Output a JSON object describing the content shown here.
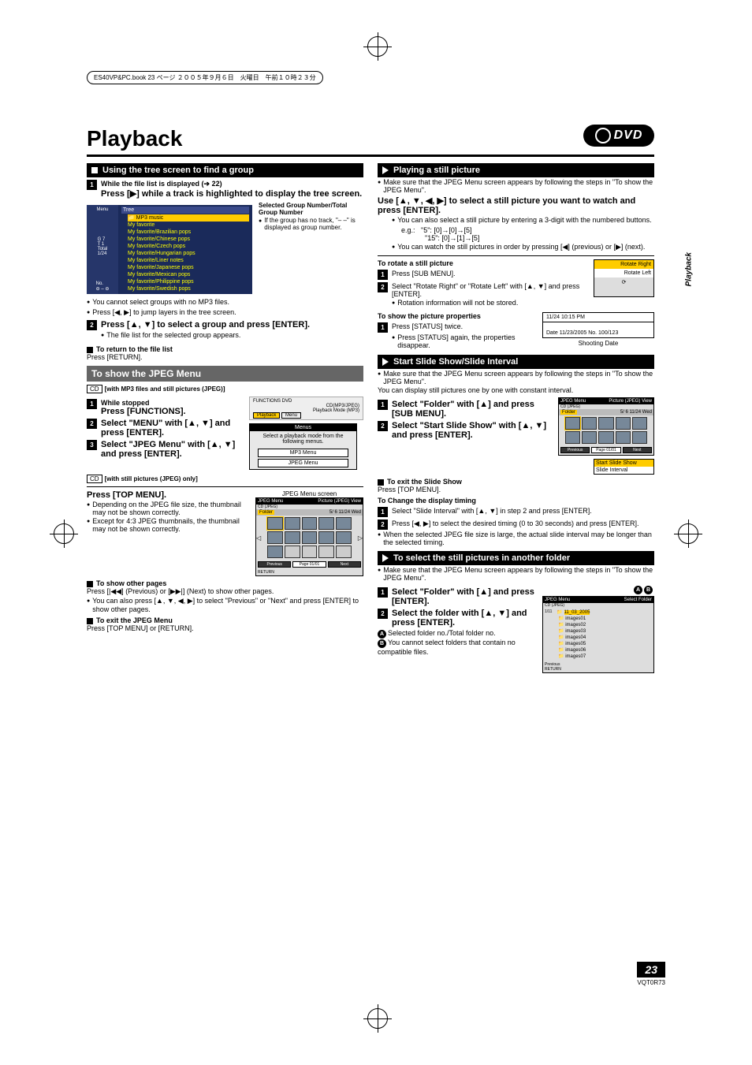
{
  "print_header": "ES40VP&PC.book  23 ページ  ２００５年９月６日　火曜日　午前１０時２３分",
  "title": "Playback",
  "dvd": "DVD",
  "side_tab": "Playback",
  "left": {
    "h1": "Using the tree screen to find a group",
    "s1_lead": "While the file list is displayed (➔ 22)",
    "s1_body": "Press [▶] while a track is highlighted to display the tree screen.",
    "tree": {
      "menu": "Menu",
      "g": "G",
      "gval": "7",
      "t": "T",
      "tval": "1",
      "total": "Total",
      "pad": "1/24",
      "no": "No.",
      "tree_hd": "Tree",
      "cur": "MP3 music",
      "items": [
        "My favorite",
        "My favorite/Brazilian pops",
        "My favorite/Chinese pops",
        "My favorite/Czech pops",
        "My favorite/Hungarian pops",
        "My favorite/Liner notes",
        "My favorite/Japanese pops",
        "My favorite/Mexican pops",
        "My favorite/Philippine pops",
        "My favorite/Swedish pops"
      ]
    },
    "tree_cap1": "Selected Group Number/Total Group Number",
    "tree_cap2": "If the group has no track, \"– –\" is displayed as group number.",
    "b1": "You cannot select groups with no MP3 files.",
    "b2": "Press [◀, ▶] to jump layers in the tree screen.",
    "s2": "Press [▲, ▼] to select a group and press [ENTER].",
    "s2_note": "The file list for the selected group appears.",
    "return_h": "To return to the file list",
    "return_t": "Press [RETURN].",
    "h2": "To show the JPEG Menu",
    "cd1": "[with MP3 files and still pictures (JPEG)]",
    "fs1": "While stopped",
    "fs1b": "Press [FUNCTIONS].",
    "fs2": "Select \"MENU\" with [▲, ▼] and press [ENTER].",
    "fs3": "Select \"JPEG Menu\" with [▲, ▼] and press [ENTER].",
    "funcbox": {
      "top1": "FUNCTIONS   DVD",
      "top2": "CD(MP3/JPEG)",
      "top3": "Playback Mode (MP3)",
      "playbtn": "Playback",
      "menubtn": "Menu",
      "hdr": "Menus",
      "sub": "Select a playback mode from the following menus.",
      "b1": "MP3 Menu",
      "b2": "JPEG Menu"
    },
    "cd2": "[with still pictures (JPEG) only]",
    "top": "Press [TOP MENU].",
    "jcap": "JPEG Menu screen",
    "jb1": "Depending on the JPEG file size, the thumbnail may not be shown correctly.",
    "jb2": "Except for 4:3 JPEG thumbnails, the thumbnail may not be shown correctly.",
    "jmenu": {
      "hd1": "JPEG Menu",
      "hd2": "Picture (JPEG) View",
      "sub": "CD (JPEG)",
      "folder": "Folder",
      "info": "5/   6   11/24  Wed",
      "prev": "Previous",
      "page": "Page 01/01",
      "next": "Next",
      "ret": "RETURN"
    },
    "other_h": "To show other pages",
    "other_t1": "Press [|◀◀] (Previous) or [▶▶|] (Next) to show other pages.",
    "other_t2": "You can also press [▲, ▼, ◀, ▶] to select \"Previous\" or \"Next\" and press [ENTER] to show other pages.",
    "exit_h": "To exit the JPEG Menu",
    "exit_t": "Press [TOP MENU] or [RETURN]."
  },
  "right": {
    "h1": "Playing a still picture",
    "p1": "Make sure that the JPEG Menu screen appears by following the steps in \"To show the JPEG Menu\".",
    "use": "Use [▲, ▼, ◀, ▶] to select a still picture you want to watch and press [ENTER].",
    "ub1": "You can also select a still picture by entering a 3-digit with the numbered buttons.",
    "eg": "e.g.:",
    "eg1": "\"5\":   [0]→[0]→[5]",
    "eg2": "\"15\":  [0]→[1]→[5]",
    "ub2": "You can watch the still pictures in order by pressing [◀] (previous) or [▶] (next).",
    "rot_h": "To rotate a still picture",
    "rot1": "Press [SUB MENU].",
    "rot2": "Select \"Rotate Right\" or \"Rotate Left\" with [▲, ▼] and press [ENTER].",
    "rot_note": "Rotation information will not be stored.",
    "rotbox": {
      "r": "Rotate Right",
      "l": "Rotate Left"
    },
    "prop_h": "To show the picture properties",
    "prop1": "Press [STATUS] twice.",
    "prop_b": "Press [STATUS] again, the properties disappear.",
    "status": {
      "t": "11/24  10:15 PM",
      "d": "Date  11/23/2005    No. 100/123"
    },
    "shooting": "Shooting Date",
    "h2": "Start Slide Show/Slide Interval",
    "s2_p": "Make sure that the JPEG Menu screen appears by following the steps in \"To show the JPEG Menu\".",
    "s2_p2": "You can display still pictures one by one with constant interval.",
    "ss1": "Select \"Folder\" with [▲] and press [SUB MENU].",
    "ss2": "Select \"Start Slide Show\" with [▲, ▼] and press [ENTER].",
    "slide": {
      "a": "Start Slide Show",
      "b": "Slide Interval"
    },
    "jmenu2": {
      "hd1": "JPEG Menu",
      "hd2": "Picture (JPEG) View",
      "sub": "CD (JPEG)",
      "folder": "Folder",
      "info": "5/   6   11/24  Wed",
      "prev": "Previous",
      "page": "Page 01/01",
      "next": "Next"
    },
    "exit2_h": "To exit the Slide Show",
    "exit2_t": "Press [TOP MENU].",
    "chg_h": "To Change the display timing",
    "chg1": "Select \"Slide Interval\" with [▲, ▼] in step 2 and press [ENTER].",
    "chg2": "Press [◀, ▶] to select the desired timing (0 to 30 seconds) and press [ENTER].",
    "chg_b": "When the selected JPEG file size is large, the actual slide interval may be longer than the selected timing.",
    "h3": "To select the still pictures in another folder",
    "f_p": "Make sure that the JPEG Menu screen appears by following the steps in \"To show the JPEG Menu\".",
    "fs1": "Select \"Folder\" with [▲] and press [ENTER].",
    "fs2": "Select the folder with [▲, ▼] and press [ENTER].",
    "fA": "Selected folder no./Total folder no.",
    "fB": "You cannot select folders that contain no compatible files.",
    "folder": {
      "hd1": "JPEG Menu",
      "hd2": "Select Folder",
      "sub": "CD (JPEG)",
      "cnt": "1/11",
      "date": "11_03_2005",
      "f": [
        "images01",
        "images02",
        "images03",
        "images04",
        "images05",
        "images06",
        "images07"
      ],
      "prev": "Previous",
      "ret": "RETURN"
    }
  },
  "page_num": "23",
  "doc_code": "VQT0R73"
}
